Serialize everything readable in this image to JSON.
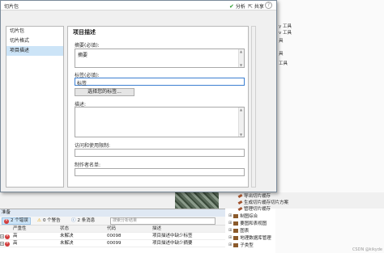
{
  "dialog": {
    "title": "切片包",
    "analyze_label": "分析",
    "share_label": "共享",
    "help_label": "?"
  },
  "nav": {
    "items": [
      {
        "label": "切片包"
      },
      {
        "label": "切片格式"
      },
      {
        "label": "项目描述"
      }
    ]
  },
  "form": {
    "section_title": "项目描述",
    "summary_label": "摘要(必填):",
    "summary_value": "摘要",
    "tags_label": "标签(必填):",
    "tags_value": "标签",
    "select_tags_button": "选择您的标签...",
    "description_label": "描述:",
    "access_label": "访问和使用限制:",
    "credits_label": "制作者名单:"
  },
  "errors": {
    "panel_title": "准备",
    "errors_button": "2 个错误",
    "warnings_button": "0 个警告",
    "messages_button": "2 条消息",
    "search_placeholder": "搜索分析结果",
    "columns": [
      "严重性",
      "状态",
      "代码",
      "描述"
    ],
    "rows": [
      {
        "severity": "高",
        "status": "未解决",
        "code": "00098",
        "description": "项目描述中缺少标签"
      },
      {
        "severity": "高",
        "status": "未解决",
        "code": "00099",
        "description": "项目描述中缺少摘要"
      }
    ]
  },
  "background": {
    "tool1": "y 工具",
    "tool2": "v 工具",
    "frag1": "具",
    "frag2": "具",
    "frag3": "工具"
  },
  "tree": {
    "items": [
      {
        "label": "导出切片缓存"
      },
      {
        "label": "生成切片缓存切片方案"
      },
      {
        "label": "管理切片缓存"
      },
      {
        "label": "制图综合"
      },
      {
        "label": "要图和表视图"
      },
      {
        "label": "图表"
      },
      {
        "label": "地理数据库管理"
      },
      {
        "label": "子类型"
      }
    ]
  },
  "watermark": "CSDN @kikyde"
}
